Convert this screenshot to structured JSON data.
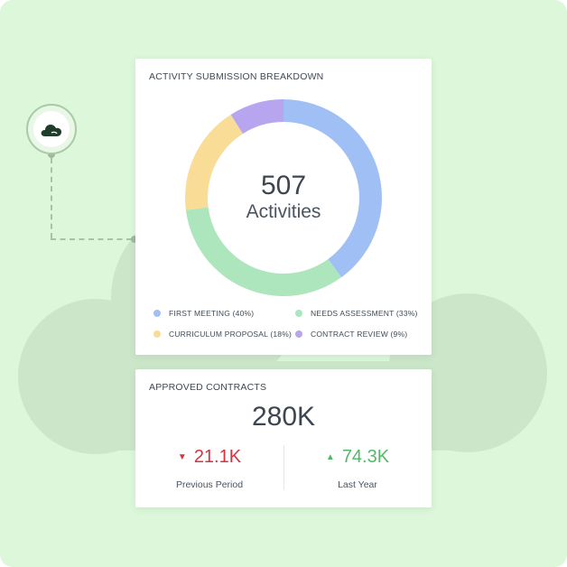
{
  "breakdown_card": {
    "title": "ACTIVITY SUBMISSION BREAKDOWN",
    "total": "507",
    "unit": "Activities",
    "legend": [
      {
        "label": "FIRST MEETING (40%)",
        "color": "#9fbff5"
      },
      {
        "label": "NEEDS ASSESSMENT (33%)",
        "color": "#ade6bd"
      },
      {
        "label": "CURRICULUM PROPOSAL (18%)",
        "color": "#f9dd96"
      },
      {
        "label": "CONTRACT REVIEW (9%)",
        "color": "#b7a6ef"
      }
    ]
  },
  "chart_data": {
    "type": "pie",
    "donut": true,
    "categories": [
      "FIRST MEETING",
      "NEEDS ASSESSMENT",
      "CURRICULUM PROPOSAL",
      "CONTRACT REVIEW"
    ],
    "values": [
      40,
      33,
      18,
      9
    ],
    "colors": [
      "#9fbff5",
      "#ade6bd",
      "#f9dd96",
      "#b7a6ef"
    ]
  },
  "contracts_card": {
    "title": "APPROVED CONTRACTS",
    "total": "280K",
    "metrics": [
      {
        "arrow": "▼",
        "value": "21.1K",
        "label": "Previous Period",
        "color": "#d8323c"
      },
      {
        "arrow": "▲",
        "value": "74.3K",
        "label": "Last Year",
        "color": "#52b96a"
      }
    ]
  },
  "badge": {
    "icon": "cloud-icon"
  }
}
